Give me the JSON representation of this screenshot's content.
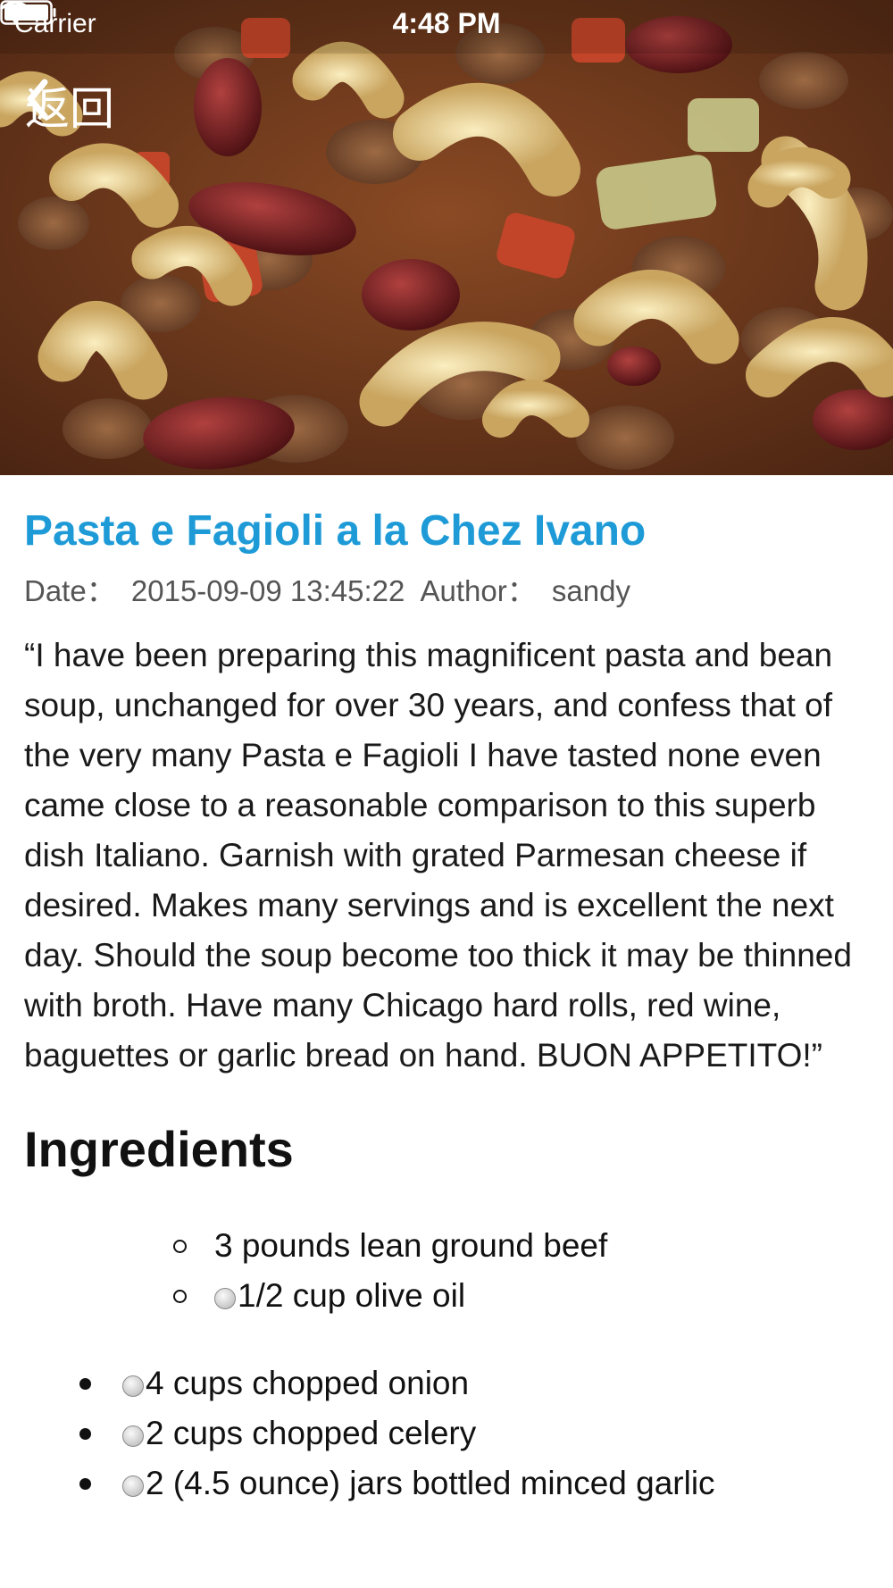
{
  "status_bar": {
    "carrier": "Carrier",
    "time": "4:48 PM"
  },
  "nav": {
    "back_label": "返回"
  },
  "recipe": {
    "title": "Pasta e Fagioli a la Chez Ivano",
    "date_label": "Date：",
    "date_value": "2015-09-09 13:45:22",
    "author_label": "Author：",
    "author_value": "sandy",
    "description": "“I have been preparing this magnificent pasta and bean soup, unchanged for over 30 years, and confess that of the very many Pasta e Fagioli I have tasted none even came close to a reasonable comparison to this superb dish Italiano. Garnish with grated Parmesan cheese if desired. Makes many servings and is excellent the next day. Should the soup become too thick it may be thinned with broth. Have many Chicago hard rolls, red wine, baguettes or garlic bread on hand. BUON APPETITO!”",
    "ingredients_heading": "Ingredients",
    "sublist": [
      {
        "text": "3 pounds lean ground beef",
        "radio": false
      },
      {
        "text": "1/2 cup olive oil",
        "radio": true
      }
    ],
    "mainlist": [
      {
        "text": "4 cups chopped onion",
        "radio": true
      },
      {
        "text": "2 cups chopped celery",
        "radio": true
      },
      {
        "text": "2 (4.5 ounce) jars bottled minced garlic",
        "radio": true
      }
    ]
  },
  "colors": {
    "title": "#1e9bd7",
    "meta": "#555555"
  }
}
